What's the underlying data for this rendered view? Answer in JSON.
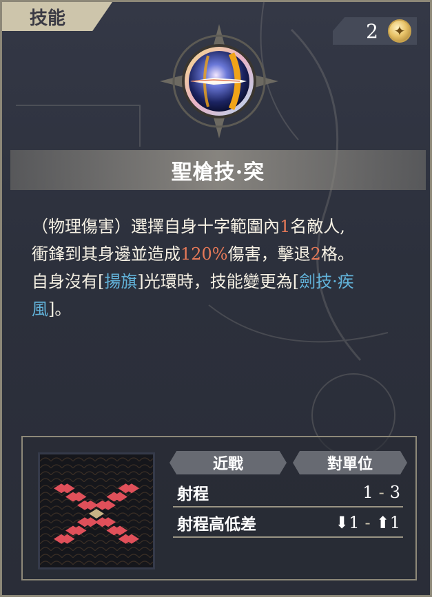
{
  "header": {
    "tab_label": "技能",
    "currency": {
      "value": "2",
      "icon": "star-coin-icon"
    }
  },
  "skill": {
    "name": "聖槍技·突",
    "icon": "holy-spear-skill-icon",
    "description": {
      "l1a": "（物理傷害）選擇自身十字範圍內",
      "l1n": "1",
      "l1b": "名敵人,",
      "l2a": "衝鋒到其身邊並造成",
      "l2n": "120%",
      "l2b": "傷害，擊退",
      "l2n2": "2",
      "l2c": "格。",
      "l3a": "自身沒有[",
      "l3k": "揚旗",
      "l3b": "]光環時，技能變更為[",
      "l3k2": "劍技·疾",
      "l4k": "風",
      "l4b": "]。"
    }
  },
  "info": {
    "type_tag": "近戰",
    "target_tag": "對單位",
    "range_label": "射程",
    "range_min": "1",
    "range_max": "3",
    "height_label": "射程高低差",
    "height_down": "⬇1",
    "height_up": "⬆1",
    "dash": "-"
  },
  "colors": {
    "highlight_number": "#e67958",
    "highlight_keyword": "#62b3da",
    "range_tile": "#e0505a",
    "center_tile": "#c8b486"
  },
  "range_pattern": "cross-diagonal"
}
